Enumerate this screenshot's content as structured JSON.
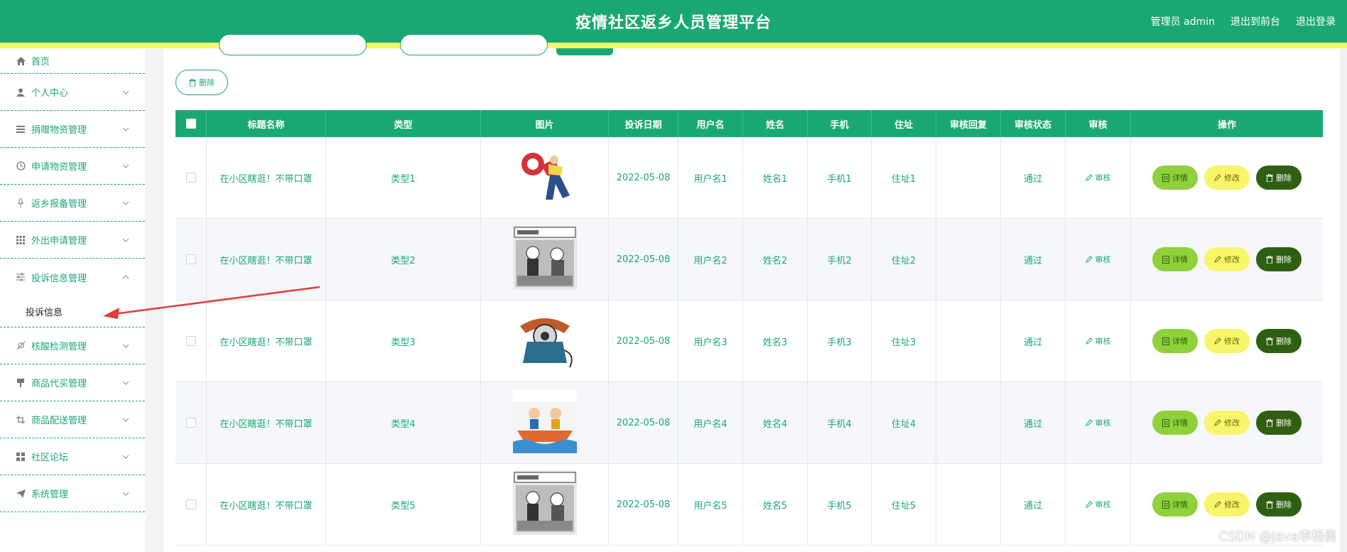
{
  "header": {
    "title": "疫情社区返乡人员管理平台",
    "user_label": "管理员 admin",
    "back_label": "退出到前台",
    "logout_label": "退出登录",
    "bg_color": "#1aa872",
    "stripe_color": "#f8f56a"
  },
  "sidebar": {
    "items": [
      {
        "label": "首页",
        "icon": "home-icon"
      },
      {
        "label": "个人中心",
        "icon": "user-icon"
      },
      {
        "label": "捐赠物资管理",
        "icon": "menu-icon"
      },
      {
        "label": "申请物资管理",
        "icon": "clock-icon"
      },
      {
        "label": "返乡报备管理",
        "icon": "microphone-icon"
      },
      {
        "label": "外出申请管理",
        "icon": "grid-icon"
      },
      {
        "label": "投诉信息管理",
        "icon": "sliders-icon"
      },
      {
        "label": "核酸检测管理",
        "icon": "bell-off-icon"
      },
      {
        "label": "商品代买管理",
        "icon": "stamp-icon"
      },
      {
        "label": "商品配送管理",
        "icon": "crop-icon"
      },
      {
        "label": "社区论坛",
        "icon": "apps-icon"
      },
      {
        "label": "系统管理",
        "icon": "send-icon"
      }
    ],
    "sub_item_label": "投诉信息"
  },
  "toolbar": {
    "delete_label": "删除"
  },
  "table": {
    "headers": [
      "标题名称",
      "类型",
      "图片",
      "投诉日期",
      "用户名",
      "姓名",
      "手机",
      "住址",
      "审核回复",
      "审核状态",
      "审核",
      "操作"
    ],
    "rows": [
      {
        "title": "在小区瞎逛！不带口罩",
        "type": "类型1",
        "image": "man-with-megaphone",
        "date": "2022-05-08",
        "username": "用户名1",
        "name": "姓名1",
        "phone": "手机1",
        "address": "住址1",
        "reply": "",
        "status": "通过"
      },
      {
        "title": "在小区瞎逛！不带口罩",
        "type": "类型2",
        "image": "comic-scene",
        "date": "2022-05-08",
        "username": "用户名2",
        "name": "姓名2",
        "phone": "手机2",
        "address": "住址2",
        "reply": "",
        "status": "通过"
      },
      {
        "title": "在小区瞎逛！不带口罩",
        "type": "类型3",
        "image": "rotary-telephone",
        "date": "2022-05-08",
        "username": "用户名3",
        "name": "姓名3",
        "phone": "手机3",
        "address": "住址3",
        "reply": "",
        "status": "通过"
      },
      {
        "title": "在小区瞎逛！不带口罩",
        "type": "类型4",
        "image": "boat-cartoon",
        "date": "2022-05-08",
        "username": "用户名4",
        "name": "姓名4",
        "phone": "手机4",
        "address": "住址4",
        "reply": "",
        "status": "通过"
      },
      {
        "title": "在小区瞎逛！不带口罩",
        "type": "类型5",
        "image": "comic-scene",
        "date": "2022-05-08",
        "username": "用户名5",
        "name": "姓名5",
        "phone": "手机5",
        "address": "住址5",
        "reply": "",
        "status": "通过"
      }
    ],
    "audit_label": "审核",
    "detail_label": "详情",
    "edit_label": "修改",
    "delete_label": "删除"
  },
  "watermark": "CSDN @java李杨勇"
}
